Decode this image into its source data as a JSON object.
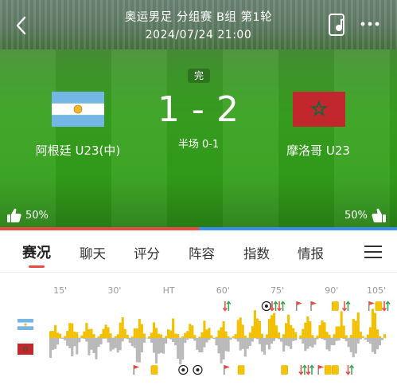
{
  "header": {
    "title": "奥运男足 分组赛 B组 第1轮",
    "datetime": "2024/07/24 21:00"
  },
  "match": {
    "status": "完",
    "home": {
      "name": "阿根廷 U23(中)",
      "flag": "argentina-flag"
    },
    "away": {
      "name": "摩洛哥 U23",
      "flag": "morocco-flag"
    },
    "home_score": "1",
    "score_sep": "-",
    "away_score": "2",
    "halftime": "半场 0-1"
  },
  "support": {
    "home_pct_label": "50%",
    "away_pct_label": "50%",
    "home_fraction": 0.5,
    "home_color": "#e84a44",
    "away_color": "#3a8ef0"
  },
  "tabs": [
    {
      "label": "赛况",
      "active": true
    },
    {
      "label": "聊天"
    },
    {
      "label": "评分"
    },
    {
      "label": "阵容"
    },
    {
      "label": "指数"
    },
    {
      "label": "情报"
    }
  ],
  "timeline": {
    "ticks": [
      "15'",
      "30'",
      "HT",
      "60'",
      "75'",
      "90'",
      "105'"
    ],
    "home_color": "#f2c000",
    "away_color": "#b9b9b9",
    "home_events": [
      {
        "type": "substitution",
        "minute": 61
      },
      {
        "type": "goal",
        "minute": 72
      },
      {
        "type": "substitution",
        "minute": 74
      },
      {
        "type": "substitution",
        "minute": 76
      },
      {
        "type": "corner",
        "minute": 81
      },
      {
        "type": "corner",
        "minute": 85
      },
      {
        "type": "yellow-card",
        "minute": 91
      },
      {
        "type": "substitution",
        "minute": 94
      },
      {
        "type": "corner",
        "minute": 101
      },
      {
        "type": "yellow-card",
        "minute": 103
      },
      {
        "type": "substitution",
        "minute": 105
      }
    ],
    "away_events": [
      {
        "type": "corner",
        "minute": 36
      },
      {
        "type": "yellow-card",
        "minute": 41
      },
      {
        "type": "goal",
        "minute": 49
      },
      {
        "type": "goal",
        "minute": 53
      },
      {
        "type": "corner",
        "minute": 61
      },
      {
        "type": "yellow-card",
        "minute": 65
      },
      {
        "type": "yellow-card",
        "minute": 77
      },
      {
        "type": "substitution",
        "minute": 82
      },
      {
        "type": "substitution",
        "minute": 84
      },
      {
        "type": "corner",
        "minute": 87
      },
      {
        "type": "yellow-card",
        "minute": 89
      },
      {
        "type": "yellow-card",
        "minute": 91
      },
      {
        "type": "substitution",
        "minute": 95
      }
    ]
  }
}
